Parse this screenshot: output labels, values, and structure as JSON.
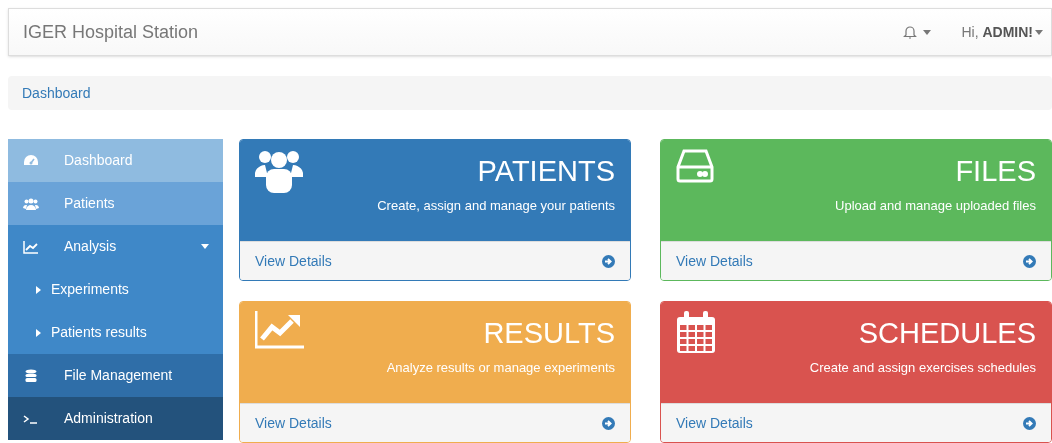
{
  "navbar": {
    "brand": "IGER Hospital Station",
    "greeting": "Hi, ",
    "user": "ADMIN!"
  },
  "breadcrumb": {
    "items": [
      "Dashboard"
    ]
  },
  "sidebar": {
    "items": [
      {
        "label": "Dashboard",
        "color": "#8fbbe0"
      },
      {
        "label": "Patients",
        "color": "#6aa3d8"
      },
      {
        "label": "Analysis",
        "color": "#3f88c8",
        "expanded": true,
        "children": [
          {
            "label": "Experiments"
          },
          {
            "label": "Patients results"
          }
        ]
      },
      {
        "label": "File Management",
        "color": "#2f6ea8"
      },
      {
        "label": "Administration",
        "color": "#23527c"
      }
    ]
  },
  "panels": [
    {
      "title": "PATIENTS",
      "description": "Create, assign and manage your patients",
      "color": "#337ab7",
      "link": "View Details"
    },
    {
      "title": "FILES",
      "description": "Upload and manage uploaded files",
      "color": "#5cb85c",
      "link": "View Details"
    },
    {
      "title": "RESULTS",
      "description": "Analyze results or manage experiments",
      "color": "#f0ad4e",
      "link": "View Details"
    },
    {
      "title": "SCHEDULES",
      "description": "Create and assign exercises schedules",
      "color": "#d9534f",
      "link": "View Details"
    }
  ]
}
